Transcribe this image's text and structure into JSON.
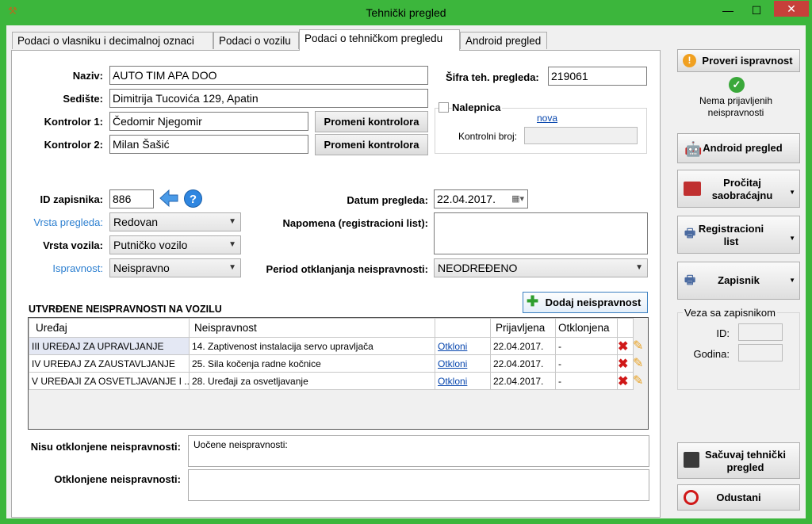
{
  "window": {
    "title": "Tehnički pregled",
    "minimize": "—",
    "maximize": "☐",
    "close": "✕"
  },
  "tabs": [
    "Podaci o vlasniku i decimalnoj oznaci",
    "Podaci o vozilu",
    "Podaci o tehničkom pregledu",
    "Android pregled"
  ],
  "form": {
    "naziv_label": "Naziv:",
    "naziv": "AUTO TIM APA DOO",
    "sediste_label": "Sedište:",
    "sediste": "Dimitrija Tucovića 129, Apatin",
    "kontrolor1_label": "Kontrolor 1:",
    "kontrolor1": "Čedomir Njegomir",
    "kontrolor2_label": "Kontrolor 2:",
    "kontrolor2": "Milan Šašić",
    "promeni_label": "Promeni kontrolora",
    "sifra_label": "Šifra teh. pregleda:",
    "sifra": "219061",
    "nalepnica_label": "Nalepnica",
    "nova_link": "nova",
    "kontrolni_label": "Kontrolni broj:",
    "kontrolni": "",
    "id_label": "ID zapisnika:",
    "id": "886",
    "vrsta_pregleda_label": "Vrsta pregleda:",
    "vrsta_pregleda": "Redovan",
    "vrsta_vozila_label": "Vrsta vozila:",
    "vrsta_vozila": "Putničko vozilo",
    "ispravnost_label": "Ispravnost:",
    "ispravnost": "Neispravno",
    "datum_label": "Datum pregleda:",
    "datum": "22.04.2017.",
    "napomena_label": "Napomena (registracioni list):",
    "napomena": "",
    "period_label": "Period otklanjanja neispravnosti:",
    "period": "NEODREĐENO"
  },
  "defects": {
    "section_title": "UTVRĐENE NEISPRAVNOSTI NA VOZILU",
    "add_button": "Dodaj neispravnost",
    "columns": [
      "Uređaj",
      "Neispravnost",
      "",
      "Prijavljena",
      "Otklonjena"
    ],
    "rows": [
      {
        "uredjaj": "III UREĐAJ ZA UPRAVLJANJE",
        "neispravnost": "14. Zaptivenost instalacija servo upravljača",
        "action": "Otkloni",
        "prijavljena": "22.04.2017.",
        "otklonjena": "-"
      },
      {
        "uredjaj": "IV UREĐAJ ZA ZAUSTAVLJANJE",
        "neispravnost": "25. Sila kočenja radne kočnice",
        "action": "Otkloni",
        "prijavljena": "22.04.2017.",
        "otklonjena": "-"
      },
      {
        "uredjaj": "V UREĐAJI ZA OSVETLJAVANJE I ...",
        "neispravnost": "28. Uređaji za osvetljavanje",
        "action": "Otkloni",
        "prijavljena": "22.04.2017.",
        "otklonjena": "-"
      }
    ]
  },
  "bottom": {
    "nisu_label": "Nisu otklonjene neispravnosti:",
    "nisu_text": "Uočene neispravnosti:",
    "otklonjene_label": "Otklonjene neispravnosti:",
    "otklonjene_text": ""
  },
  "side": {
    "proveri": "Proveri ispravnost",
    "status": "Nema prijavljenih neispravnosti",
    "android": "Android pregled",
    "procitaj": "Pročitaj saobraćajnu",
    "registracioni": "Registracioni list",
    "zapisnik": "Zapisnik",
    "veza_title": "Veza sa zapisnikom",
    "veza_id_label": "ID:",
    "veza_godina_label": "Godina:",
    "sacuvaj": "Sačuvaj tehnički pregled",
    "odustani": "Odustani"
  },
  "colors": {
    "titlebar": "#3cb63c",
    "label_blue": "#2c7fd0",
    "link": "#0645ad",
    "close": "#c7403a"
  }
}
